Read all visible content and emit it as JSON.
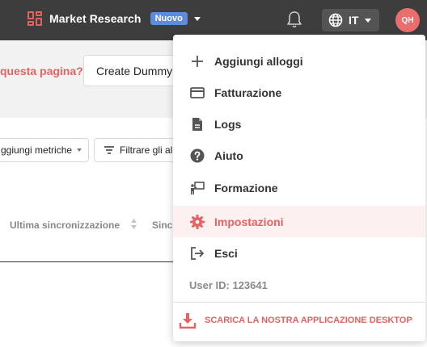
{
  "header": {
    "app_name": "Market Research",
    "badge": "Nuovo",
    "language": "IT",
    "avatar_initials": "QH"
  },
  "page": {
    "question": "questa pagina?",
    "create_button": "Create Dummy",
    "chip_add_metrics": "ggiungi metriche",
    "chip_filter": "Filtrare gli al",
    "columns": [
      "Ultima sincronizzazione",
      "Sincr"
    ]
  },
  "menu": {
    "items": [
      {
        "label": "Aggiungi alloggi",
        "icon": "plus-icon"
      },
      {
        "label": "Fatturazione",
        "icon": "credit-card-icon"
      },
      {
        "label": "Logs",
        "icon": "document-icon"
      },
      {
        "label": "Aiuto",
        "icon": "help-circle-icon"
      },
      {
        "label": "Formazione",
        "icon": "training-presenter-icon"
      },
      {
        "label": "Impostazioni",
        "icon": "gear-icon",
        "active": true
      },
      {
        "label": "Esci",
        "icon": "logout-icon"
      }
    ],
    "user_id": "User ID: 123641",
    "download_label": "SCARICA LA NOSTRA APPLICAZIONE DESKTOP"
  },
  "colors": {
    "accent": "#e46262",
    "topbar": "#3d3d3d",
    "badge": "#5d8be0"
  }
}
